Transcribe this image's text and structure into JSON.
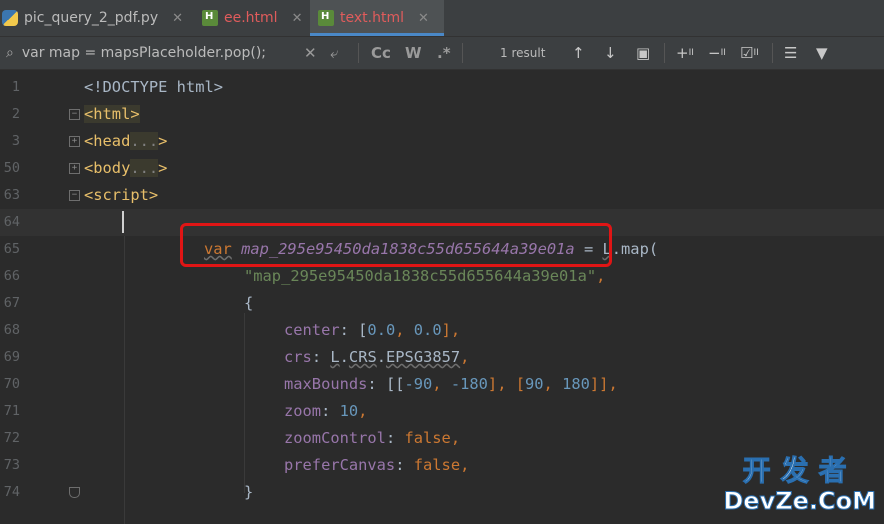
{
  "tabs": [
    {
      "label": "pic_query_2_pdf.py",
      "icon": "python-file-icon",
      "active": false
    },
    {
      "label": "ee.html",
      "icon": "html-file-icon",
      "active": false
    },
    {
      "label": "text.html",
      "icon": "html-file-icon",
      "active": true
    }
  ],
  "search": {
    "query": "var map = mapsPlaceholder.pop();",
    "results": "1 result",
    "match_case": "Cc",
    "words": "W",
    "regex": ".*"
  },
  "lines": [
    {
      "num": "1"
    },
    {
      "num": "2"
    },
    {
      "num": "3"
    },
    {
      "num": "50"
    },
    {
      "num": "63"
    },
    {
      "num": "64"
    },
    {
      "num": "65"
    },
    {
      "num": "66"
    },
    {
      "num": "67"
    },
    {
      "num": "68"
    },
    {
      "num": "69"
    },
    {
      "num": "70"
    },
    {
      "num": "71"
    },
    {
      "num": "72"
    },
    {
      "num": "73"
    },
    {
      "num": "74"
    }
  ],
  "code": {
    "doctype": "<!DOCTYPE html>",
    "html_tag": "<html>",
    "head_open": "<head",
    "head_fold": "...",
    "head_close": ">",
    "body_open": "<body",
    "body_fold": "...",
    "body_close": ">",
    "script_tag": "<script>",
    "var_kw": "var",
    "map_var": "map_295e95450da1838c55d655644a39e01a",
    "assign": " = ",
    "L": "L",
    "map_call": ".map(",
    "map_id_str": "\"map_295e95450da1838c55d655644a39e01a\"",
    "comma": ",",
    "brace_open": "{",
    "center_key": "center",
    "center_val_open": ": [",
    "center_x": "0.0",
    "center_sep": ", ",
    "center_y": "0.0",
    "center_close": "],",
    "crs_key": "crs",
    "crs_colon": ": ",
    "crs_L": "L",
    "crs_dot1": ".",
    "crs_CRS": "CRS",
    "crs_dot2": ".",
    "crs_epsg": "EPSG3857",
    "crs_comma": ",",
    "maxb_key": "maxBounds",
    "maxb_open": ": [[",
    "maxb_a": "-90",
    "maxb_s1": ", ",
    "maxb_b": "-180",
    "maxb_mid": "], [",
    "maxb_c": "90",
    "maxb_s2": ", ",
    "maxb_d": "180",
    "maxb_close": "]],",
    "zoom_key": "zoom",
    "zoom_colon": ": ",
    "zoom_val": "10",
    "zoom_comma": ",",
    "zc_key": "zoomControl",
    "zc_colon": ": ",
    "zc_val": "false",
    "zc_comma": ",",
    "pc_key": "preferCanvas",
    "pc_colon": ": ",
    "pc_val": "false",
    "pc_comma": ",",
    "brace_close": "}"
  },
  "watermark": {
    "cn": "开发者",
    "en": "DevZe.CoM"
  }
}
